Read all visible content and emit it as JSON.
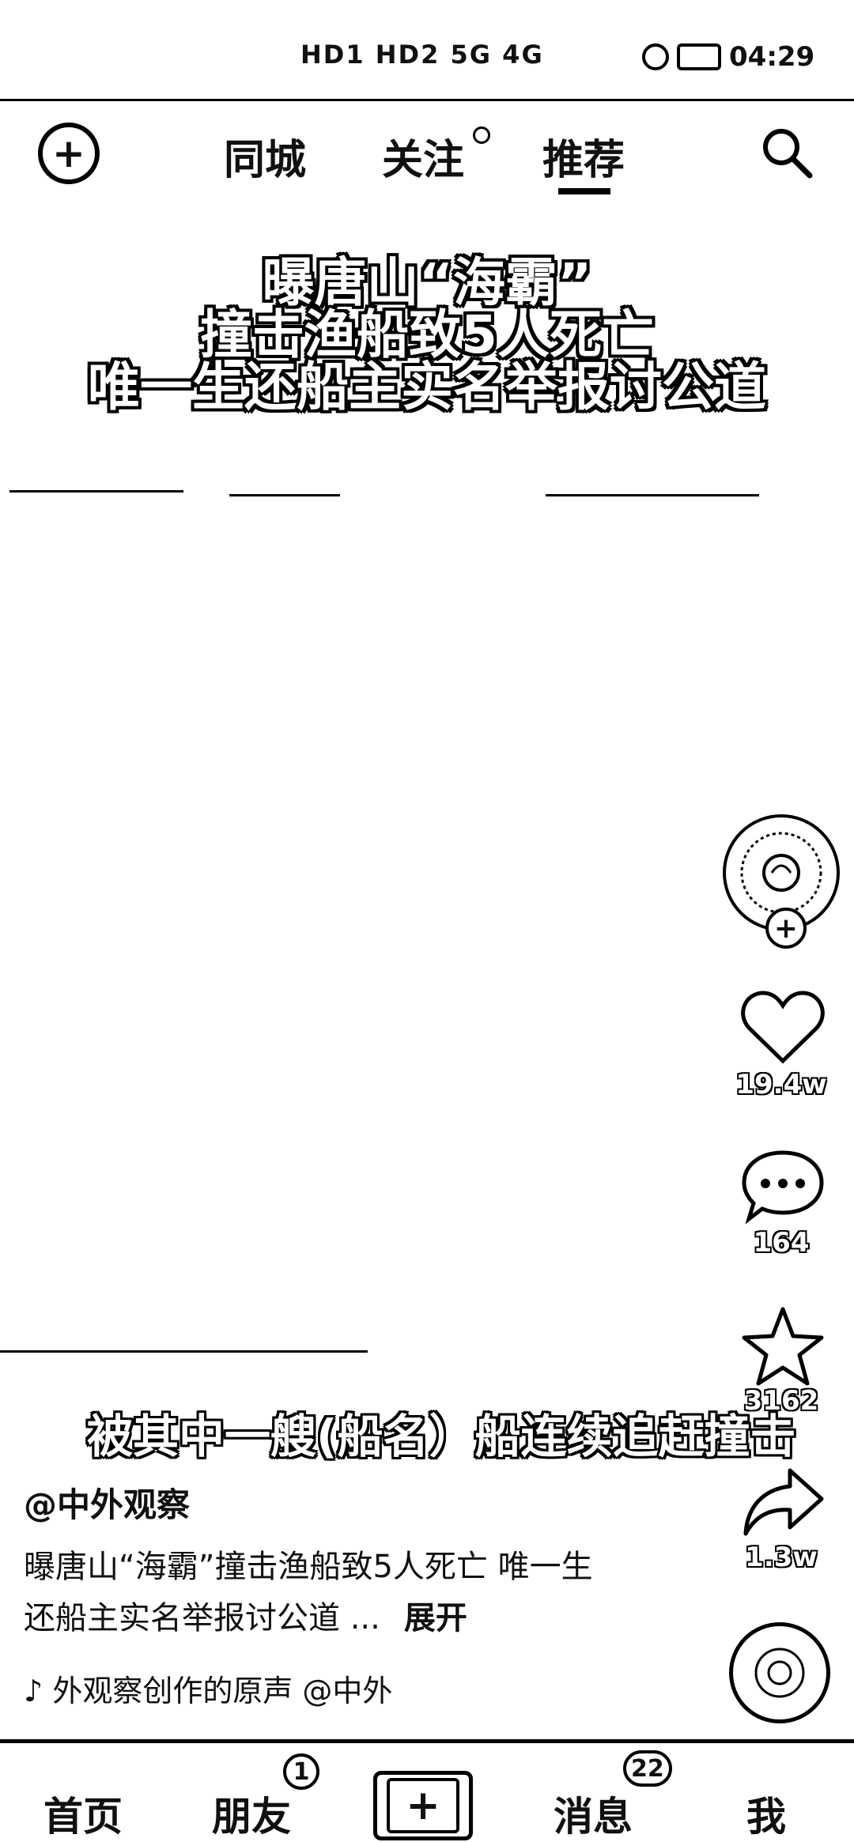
{
  "status": {
    "sim_labels": "HD1 HD2 5G 4G",
    "time": "04:29"
  },
  "topnav": {
    "tabs": [
      "同城",
      "关注",
      "推荐"
    ],
    "active_tab": "推荐"
  },
  "video": {
    "headline_lines": [
      "曝唐山“海霸”",
      "撞击渔船致5人死亡",
      "唯一生还船主实名举报讨公道"
    ],
    "subtitle": "被其中一艘(船名）船连续追赶撞击"
  },
  "rail": {
    "likes": "19.4w",
    "comments": "164",
    "favorites": "3162",
    "shares": "1.3w"
  },
  "post": {
    "author": "@中外观察",
    "description": "曝唐山“海霸”撞击渔船致5人死亡 唯一生还船主实名举报讨公道 ...",
    "expand_label": "展开",
    "music": "♪ 外观察创作的原声 @中外"
  },
  "bottom": {
    "home": "首页",
    "friends": "朋友",
    "friends_badge": "1",
    "messages": "消息",
    "messages_badge": "22",
    "me": "我"
  },
  "icons": {
    "add": "circle-plus-icon",
    "search": "search-icon",
    "like": "heart-icon",
    "comment": "comment-bubble-icon",
    "favorite": "star-icon",
    "share": "share-arrow-icon"
  }
}
